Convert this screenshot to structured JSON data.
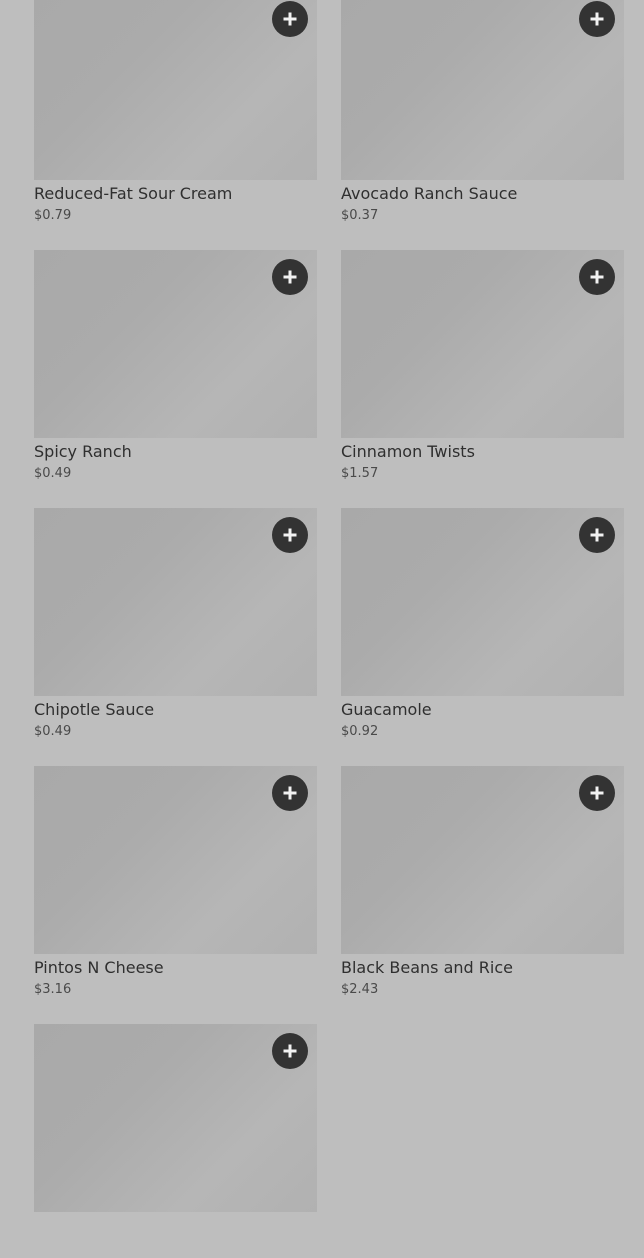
{
  "menu": {
    "items": [
      {
        "name": "Reduced-Fat Sour Cream",
        "price": "$0.79",
        "add_icon": "plus-icon"
      },
      {
        "name": "Avocado Ranch Sauce",
        "price": "$0.37",
        "add_icon": "plus-icon"
      },
      {
        "name": "Spicy Ranch",
        "price": "$0.49",
        "add_icon": "plus-icon"
      },
      {
        "name": "Cinnamon Twists",
        "price": "$1.57",
        "add_icon": "plus-icon"
      },
      {
        "name": "Chipotle Sauce",
        "price": "$0.49",
        "add_icon": "plus-icon"
      },
      {
        "name": "Guacamole",
        "price": "$0.92",
        "add_icon": "plus-icon"
      },
      {
        "name": "Pintos N Cheese",
        "price": "$3.16",
        "add_icon": "plus-icon"
      },
      {
        "name": "Black Beans and Rice",
        "price": "$2.43",
        "add_icon": "plus-icon"
      },
      {
        "name": "",
        "price": "",
        "add_icon": "plus-icon"
      }
    ]
  },
  "colors": {
    "page_background": "#bebebe",
    "add_button": "#333333",
    "text": "#2f2f2f"
  }
}
